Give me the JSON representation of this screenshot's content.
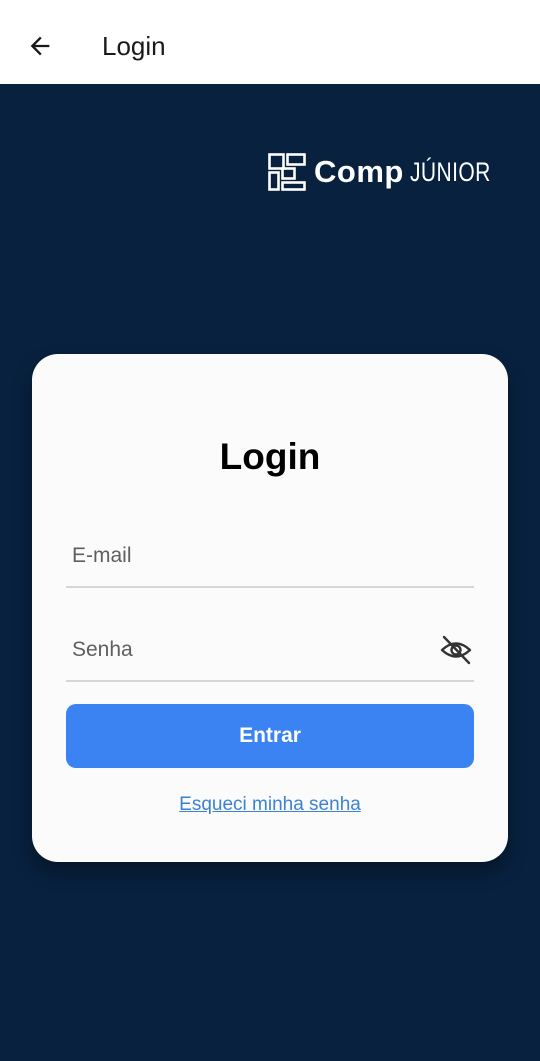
{
  "appbar": {
    "title": "Login",
    "back_icon": "arrow-left-icon"
  },
  "logo": {
    "brand_main": "Comp",
    "brand_sub": "JÚNIOR",
    "mark_icon": "comp-junior-logo-mark"
  },
  "login_card": {
    "title": "Login",
    "email": {
      "placeholder": "E-mail",
      "value": ""
    },
    "password": {
      "placeholder": "Senha",
      "value": "",
      "toggle_icon": "eye-off-icon"
    },
    "submit_label": "Entrar",
    "forgot_link": "Esqueci minha senha"
  },
  "colors": {
    "background": "#08213f",
    "appbar": "#ffffff",
    "card": "#fbfbfb",
    "primary": "#3b82f3",
    "link": "#3b82d6"
  }
}
